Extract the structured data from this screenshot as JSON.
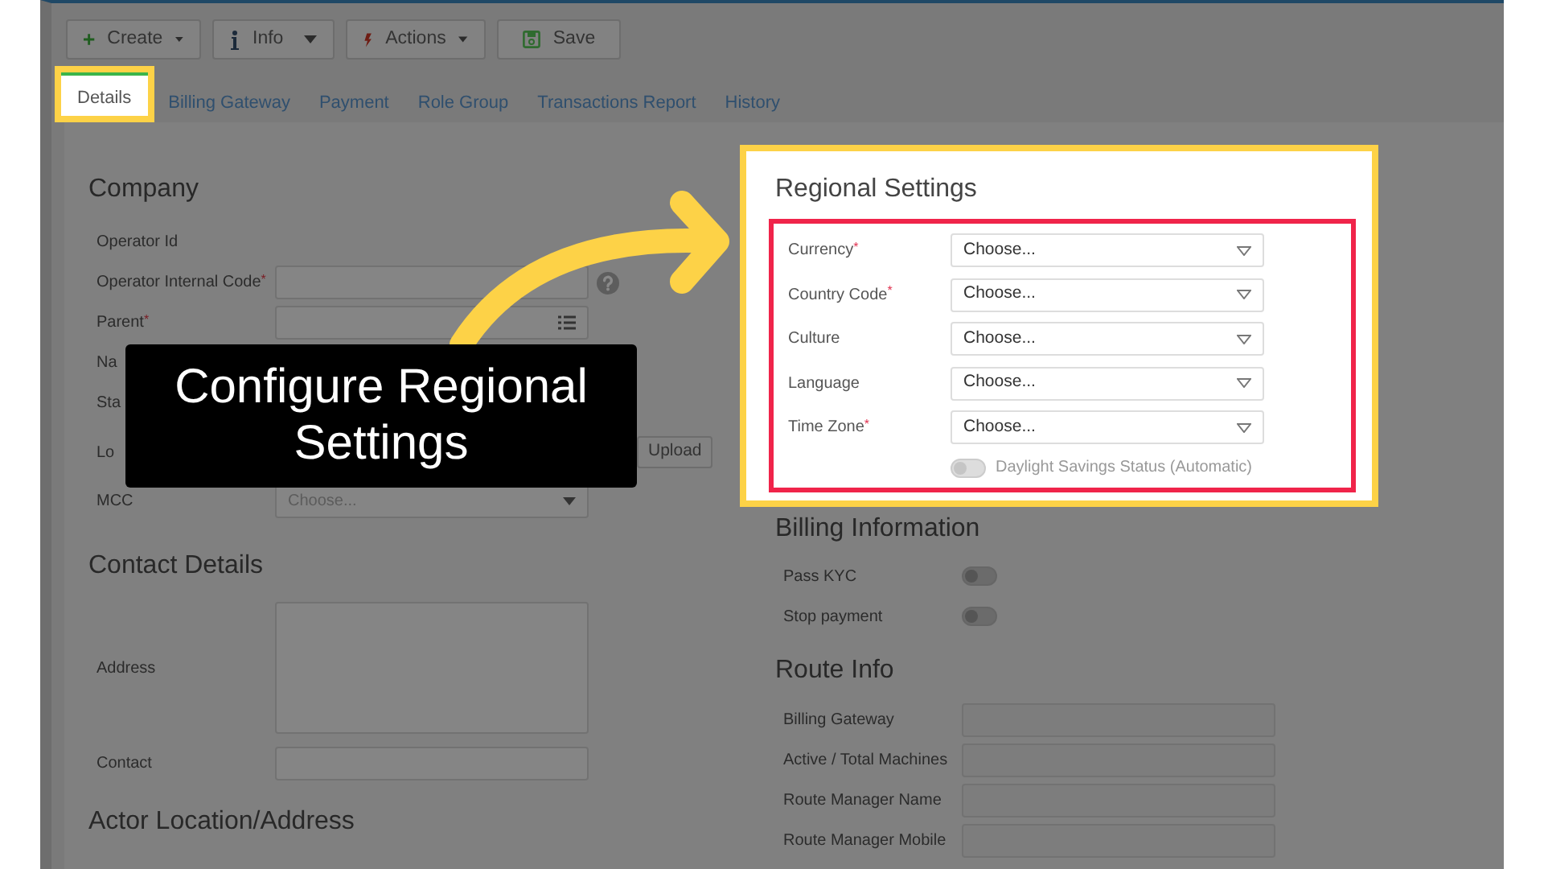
{
  "toolbar": [
    {
      "label": "Create",
      "kind": "dropdown"
    },
    {
      "label": "Info",
      "kind": "dropdown"
    },
    {
      "label": "Actions",
      "kind": "dropdown"
    },
    {
      "label": "Save",
      "kind": "plain"
    }
  ],
  "tabs": [
    {
      "label": "Details",
      "selected": true
    },
    {
      "label": "Billing Gateway",
      "selected": false
    },
    {
      "label": "Payment",
      "selected": false
    },
    {
      "label": "Role Group",
      "selected": false
    },
    {
      "label": "Transactions Report",
      "selected": false
    },
    {
      "label": "History",
      "selected": false
    }
  ],
  "company": {
    "title": "Company",
    "fields": [
      {
        "label": "Operator Id",
        "kind": "none"
      },
      {
        "label": "Operator Internal Code$^{*}$",
        "kind": "help"
      },
      {
        "label": "Parent$^{*}$",
        "kind": "list"
      },
      {
        "label": "Na",
        "kind": "none"
      },
      {
        "label": "Sta",
        "kind": "none"
      },
      {
        "label": "Lo",
        "kind": "upload",
        "button": "Upload"
      },
      {
        "label": "MCC",
        "kind": "select",
        "placeholder": "Choose..."
      }
    ]
  },
  "contact": {
    "title": "Contact Details",
    "fields": [
      {
        "label": "Address",
        "kind": "textarea"
      },
      {
        "label": "Contact",
        "kind": "input"
      }
    ]
  },
  "actor_location": {
    "title": "Actor Location/Address"
  },
  "regional": {
    "title": "Regional Settings",
    "fields": [
      {
        "label": "Currency$^{*}$",
        "placeholder": "Choose..."
      },
      {
        "label": "Country Code$^{*}$",
        "placeholder": "Choose..."
      },
      {
        "label": "Culture",
        "placeholder": "Choose..."
      },
      {
        "label": "Language",
        "placeholder": "Choose..."
      },
      {
        "label": "Time Zone$^{*}$",
        "placeholder": "Choose..."
      }
    ],
    "toggle": {
      "label": "Daylight Savings Status (Automatic)",
      "on": false
    }
  },
  "billing": {
    "title": "Billing Information",
    "toggles": [
      {
        "label": "Pass KYC",
        "on": false
      },
      {
        "label": "Stop payment",
        "on": false
      }
    ]
  },
  "route": {
    "title": "Route Info",
    "fields": [
      {
        "label": "Billing Gateway"
      },
      {
        "label": "Active / Total Machines"
      },
      {
        "label": "Route Manager Name"
      },
      {
        "label": "Route Manager Mobile"
      }
    ]
  },
  "caption": "Configure Regional Settings"
}
